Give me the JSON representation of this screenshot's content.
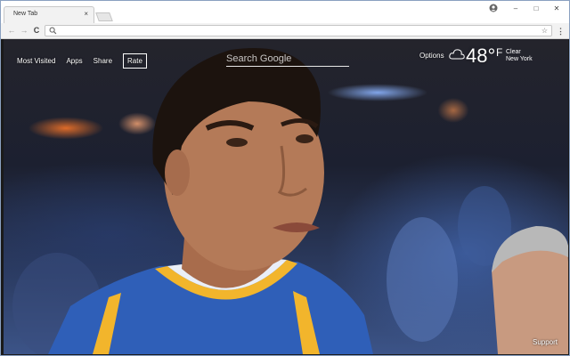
{
  "tab": {
    "title": "New Tab",
    "close": "×"
  },
  "window_controls": {
    "minimize": "–",
    "maximize": "□",
    "close": "✕"
  },
  "toolbar": {
    "back": "←",
    "forward": "→",
    "reload": "C",
    "star": "☆",
    "menu": "⋮"
  },
  "omnibox": {
    "value": ""
  },
  "nav": {
    "most_visited": "Most Visited",
    "apps": "Apps",
    "share": "Share",
    "rate": "Rate"
  },
  "search": {
    "placeholder": "Search Google"
  },
  "options_label": "Options",
  "weather": {
    "icon": "cloud-icon",
    "temperature": "48°",
    "unit": "F",
    "condition": "Clear",
    "city": "New York"
  },
  "support_label": "Support",
  "colors": {
    "jersey_blue": "#2f5fb8",
    "jersey_gold": "#f2b52c",
    "skin": "#b47a58"
  }
}
